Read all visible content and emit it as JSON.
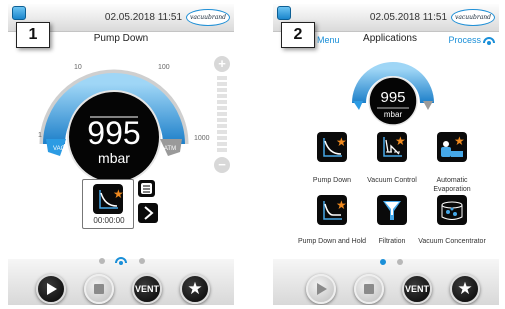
{
  "colors": {
    "accent": "#1a8fd8",
    "gauge_blue": "#2c9be3",
    "dark": "#0a0a0a"
  },
  "screen1": {
    "label_number": "1",
    "status": {
      "datetime": "02.05.2018   11:51",
      "logo": "vacuubrand"
    },
    "title": "Pump Down",
    "gauge": {
      "value": "995",
      "unit": "mbar",
      "scale": [
        "1",
        "10",
        "100",
        "1000"
      ],
      "vac_label": "VAC",
      "atm_label": "ATM"
    },
    "program": {
      "icon": "pump-down-icon",
      "timer": "00:00:00"
    },
    "slider": {
      "plus": "+",
      "minus": "−"
    },
    "controls": {
      "vent_label": "VENT"
    }
  },
  "screen2": {
    "label_number": "2",
    "status": {
      "datetime": "02.05.2018   11:51",
      "logo": "vacuubrand"
    },
    "nav": {
      "menu": "Menu",
      "title": "Applications",
      "process": "Process"
    },
    "gauge": {
      "value": "995",
      "unit": "mbar"
    },
    "apps": [
      {
        "label": "Pump Down",
        "icon": "pump-down-icon"
      },
      {
        "label": "Vacuum Control",
        "icon": "vacuum-control-icon"
      },
      {
        "label": "Automatic Evaporation",
        "icon": "automatic-evaporation-icon"
      },
      {
        "label": "Pump Down and Hold",
        "icon": "pump-down-hold-icon"
      },
      {
        "label": "Filtration",
        "icon": "filtration-icon"
      },
      {
        "label": "Vacuum Concentrator",
        "icon": "vacuum-concentrator-icon"
      }
    ],
    "controls": {
      "vent_label": "VENT"
    }
  }
}
